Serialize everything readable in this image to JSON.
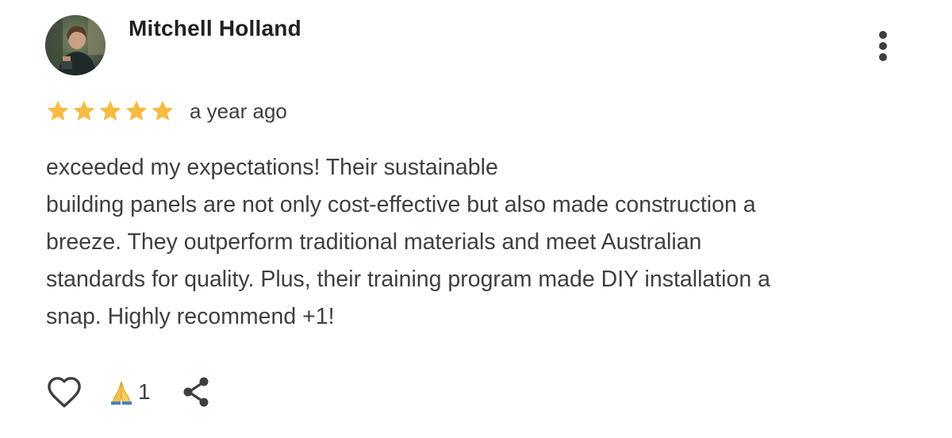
{
  "reviewer": {
    "name": "Mitchell Holland"
  },
  "review": {
    "rating": 5,
    "rating_max": 5,
    "timestamp": "a year ago",
    "lines": [
      "exceeded my expectations! Their sustainable",
      "building panels are not only cost-effective but also made construction a",
      "breeze. They outperform traditional materials and meet Australian",
      "standards for quality. Plus, their training program made DIY installation a",
      "snap. Highly recommend +1!"
    ]
  },
  "actions": {
    "reaction_emoji": "🙏",
    "reaction_count": "1",
    "icons": [
      "heart-outline-icon",
      "folded-hands-icon",
      "share-icon",
      "more-vert-icon"
    ]
  },
  "colors": {
    "star": "#f6bb42",
    "text": "#3c4043",
    "name": "#202124"
  }
}
